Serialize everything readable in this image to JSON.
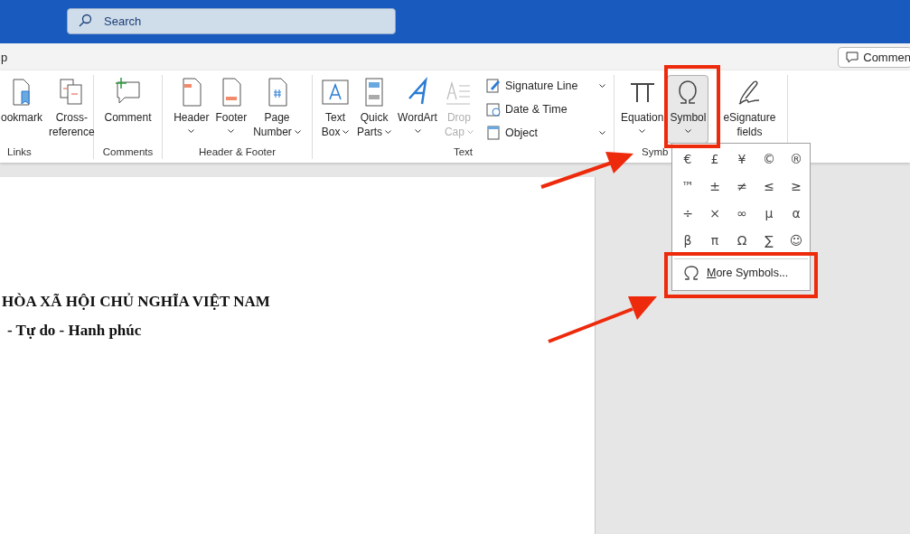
{
  "search": {
    "placeholder": "Search"
  },
  "tab_row": {
    "cut_tab": "p",
    "comments_button": "Commen"
  },
  "ribbon": {
    "groups": [
      {
        "label": "Links",
        "items": [
          {
            "kind": "large",
            "lines": [
              "ookmark"
            ],
            "dropdown": false,
            "selected": false,
            "disabled": false
          },
          {
            "kind": "large",
            "lines": [
              "Cross-",
              "reference"
            ],
            "dropdown": false,
            "selected": false,
            "disabled": false
          }
        ]
      },
      {
        "label": "Comments",
        "items": [
          {
            "kind": "large",
            "lines": [
              "Comment"
            ],
            "dropdown": false,
            "selected": false,
            "disabled": false
          }
        ]
      },
      {
        "label": "Header & Footer",
        "items": [
          {
            "kind": "large",
            "lines": [
              "Header"
            ],
            "dropdown": true,
            "selected": false,
            "disabled": false
          },
          {
            "kind": "large",
            "lines": [
              "Footer"
            ],
            "dropdown": true,
            "selected": false,
            "disabled": false
          },
          {
            "kind": "large",
            "lines": [
              "Page",
              "Number"
            ],
            "dropdown": true,
            "selected": false,
            "disabled": false
          }
        ]
      },
      {
        "label": "Text",
        "items": [
          {
            "kind": "large",
            "lines": [
              "Text",
              "Box"
            ],
            "dropdown": true,
            "selected": false,
            "disabled": false
          },
          {
            "kind": "large",
            "lines": [
              "Quick",
              "Parts"
            ],
            "dropdown": true,
            "selected": false,
            "disabled": false
          },
          {
            "kind": "large",
            "lines": [
              "WordArt"
            ],
            "dropdown": true,
            "selected": false,
            "disabled": false
          },
          {
            "kind": "large",
            "lines": [
              "Drop",
              "Cap"
            ],
            "dropdown": true,
            "selected": false,
            "disabled": true
          },
          {
            "kind": "stack",
            "entries": [
              {
                "label": "Signature Line",
                "dropdown": true
              },
              {
                "label": "Date & Time",
                "dropdown": false
              },
              {
                "label": "Object",
                "dropdown": true
              }
            ]
          }
        ]
      },
      {
        "label": "Symb",
        "items": [
          {
            "kind": "large",
            "lines": [
              "Equation"
            ],
            "dropdown": true,
            "selected": false,
            "disabled": false
          },
          {
            "kind": "large",
            "lines": [
              "Symbol"
            ],
            "dropdown": true,
            "selected": true,
            "disabled": false
          },
          {
            "kind": "large",
            "lines": [
              "eSignature",
              "fields"
            ],
            "dropdown": false,
            "selected": false,
            "disabled": false
          }
        ]
      }
    ]
  },
  "symbol_menu": {
    "symbols": [
      "€",
      "£",
      "¥",
      "©",
      "®",
      "™",
      "±",
      "≠",
      "≤",
      "≥",
      "÷",
      "×",
      "∞",
      "µ",
      "α",
      "β",
      "π",
      "Ω",
      "∑",
      "☺"
    ],
    "more": "More Symbols..."
  },
  "document": {
    "lines": [
      "HÒA XÃ HỘI CHỦ NGHĨA VIỆT NAM",
      "- Tự do - Hanh phúc"
    ]
  }
}
